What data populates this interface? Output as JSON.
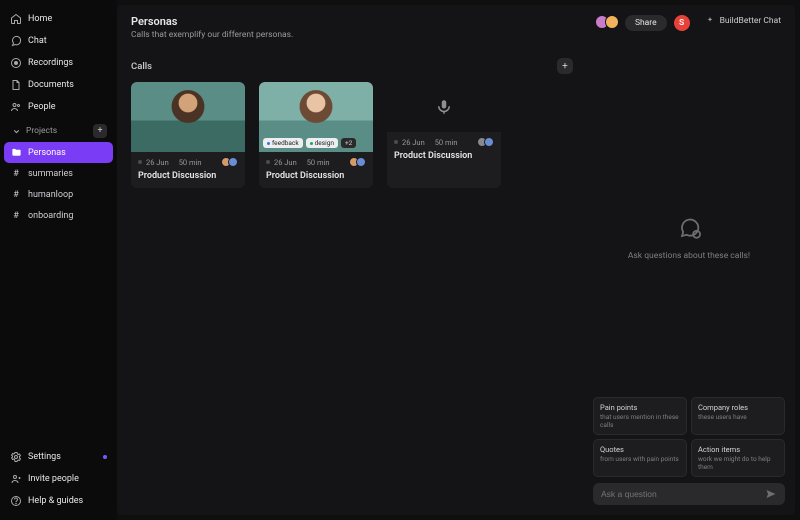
{
  "sidebar": {
    "nav": [
      {
        "key": "home",
        "label": "Home"
      },
      {
        "key": "chat",
        "label": "Chat"
      },
      {
        "key": "recordings",
        "label": "Recordings"
      },
      {
        "key": "documents",
        "label": "Documents"
      },
      {
        "key": "people",
        "label": "People"
      }
    ],
    "projects_header": "Projects",
    "projects": [
      {
        "key": "personas",
        "label": "Personas",
        "icon": "folder",
        "active": true
      },
      {
        "key": "summaries",
        "label": "summaries",
        "icon": "hash"
      },
      {
        "key": "humanloop",
        "label": "humanloop",
        "icon": "hash"
      },
      {
        "key": "onboarding",
        "label": "onboarding",
        "icon": "hash"
      }
    ],
    "footer": [
      {
        "key": "settings",
        "label": "Settings",
        "indicator": true
      },
      {
        "key": "invite",
        "label": "Invite people"
      },
      {
        "key": "help",
        "label": "Help & guides"
      }
    ]
  },
  "header": {
    "title": "Personas",
    "subtitle": "Calls that exemplify our different personas.",
    "share": "Share",
    "user_initial": "S",
    "chat_label": "BuildBetter Chat"
  },
  "calls": {
    "heading": "Calls",
    "items": [
      {
        "date": "26 Jun",
        "duration": "50 min",
        "title": "Product Discussion",
        "thumb": "person1",
        "tags": []
      },
      {
        "date": "26 Jun",
        "duration": "50 min",
        "title": "Product Discussion",
        "thumb": "person2",
        "tags": [
          {
            "label": "feedback",
            "color": "blue"
          },
          {
            "label": "design",
            "color": "green"
          },
          {
            "label": "+2",
            "more": true
          }
        ]
      },
      {
        "date": "26 Jun",
        "duration": "50 min",
        "title": "Product Discussion",
        "thumb": "audio",
        "tags": []
      }
    ]
  },
  "chat": {
    "prompt": "Ask questions about these calls!",
    "suggestions": [
      {
        "title": "Pain points",
        "sub": "that users mention in these calls"
      },
      {
        "title": "Company roles",
        "sub": "these users have"
      },
      {
        "title": "Quotes",
        "sub": "from users with pain points"
      },
      {
        "title": "Action items",
        "sub": "work we might do to help them"
      }
    ],
    "input_placeholder": "Ask a question"
  },
  "colors": {
    "accent": "#7b3cf5",
    "danger": "#e7413a"
  }
}
